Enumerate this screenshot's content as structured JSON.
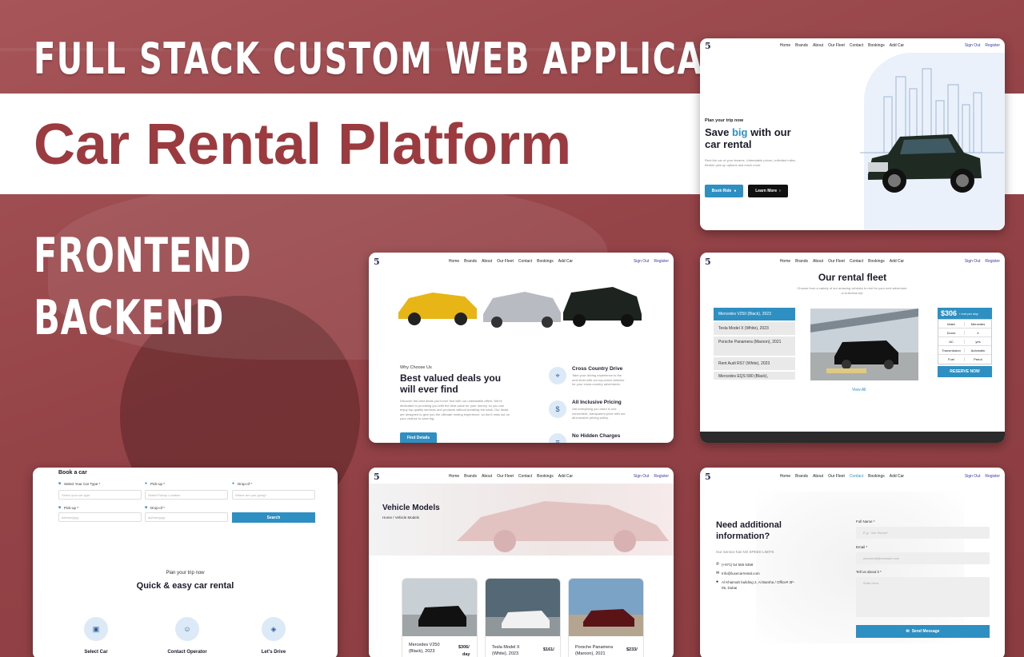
{
  "banner": {
    "headline": "FULL STACK CUSTOM WEB APPLICATION",
    "subtitle": "Car Rental Platform",
    "tags": [
      "FRONTEND",
      "BACKEND"
    ]
  },
  "nav": {
    "logo": "5",
    "links": [
      "Home",
      "Brands",
      "About",
      "Our Fleet",
      "Contact",
      "Bookings",
      "Add Car"
    ],
    "sign_out": "Sign Out",
    "register": "Register"
  },
  "hero": {
    "kicker": "Plan your trip now",
    "title_pre": "Save ",
    "title_accent": "big",
    "title_post": " with our",
    "title_line2": "car rental",
    "desc": "Rent the car of your dreams. Unbeatable prices, unlimited miles, flexible pick-up options and much more.",
    "book_ride": "Book Ride",
    "learn_more": "Learn More"
  },
  "why": {
    "kicker": "Why Choose Us",
    "title1": "Best valued deals you",
    "title2": "will ever find",
    "desc": "Discover the best deals you'll ever find with our unbeatable offers. We're dedicated to providing you with the best value for your money, so you can enjoy top-quality services and products without breaking the bank. Our deals are designed to give you the ultimate renting experience, so don't miss out on your chance to save big.",
    "find_details": "Find Details",
    "features": [
      {
        "title": "Cross Country Drive",
        "desc": "Take your driving experience to the next level with our top-notch vehicles for your cross-country adventures."
      },
      {
        "title": "All Inclusive Pricing",
        "desc": "Get everything you need in one convenient, transparent price with our all-inclusive pricing policy."
      },
      {
        "title": "No Hidden Charges",
        "desc": ""
      }
    ]
  },
  "fleet": {
    "title": "Our rental fleet",
    "desc": "Choose from a variety of our amazing vehicles to rent for your next adventure or business trip",
    "cars": [
      "Mercedes V250 (Black), 2023",
      "Tesla Model X (White), 2023",
      "Porsche Panamera (Maroon), 2021",
      "Rent Audi RS7 (White), 2023",
      "Mercedes EQS 580 (Black),"
    ],
    "price": "$306",
    "price_unit": "/ rent per day",
    "specs": [
      [
        "Make",
        "Mercedes"
      ],
      [
        "Doors",
        "4"
      ],
      [
        "AC",
        "yes"
      ],
      [
        "Transmission",
        "Automatic"
      ],
      [
        "Fuel",
        "Petrol"
      ]
    ],
    "reserve": "RESERVE NOW",
    "view_all": "View All"
  },
  "booking": {
    "title": "Book a car",
    "car_type_label": "Select Your Car Type *",
    "car_type_ph": "Select your car type",
    "pickup_label": "Pick-up *",
    "pickup_ph": "Select Pickup Location",
    "dropoff_label": "Drop-of *",
    "dropoff_ph": "Where are you going?",
    "pickup_date_label": "Pick-up *",
    "pickup_date_ph": "dd/mm/yyyy",
    "dropoff_date_label": "Drop-of *",
    "dropoff_date_ph": "dd/mm/yyyy",
    "search": "Search",
    "kicker": "Plan your trip now",
    "heading": "Quick & easy car rental",
    "steps": [
      "Select Car",
      "Contact Operator",
      "Let's Drive"
    ]
  },
  "models": {
    "title": "Vehicle Models",
    "crumb": "Home / Vehicle Models",
    "cards": [
      {
        "name1": "Mercedes V250",
        "name2": "(Black), 2023",
        "price1": "$306/",
        "price2": "day"
      },
      {
        "name1": "Tesla Model X",
        "name2": "(White), 2023",
        "price1": "$161/",
        "price2": ""
      },
      {
        "name1": "Porsche Panamera",
        "name2": "(Maroon), 2021",
        "price1": "$233/",
        "price2": ""
      }
    ]
  },
  "contact": {
    "title1": "Need additional",
    "title2": "information?",
    "desc": "Our Service has NO SPEED LIMITS",
    "phone": "(+971) 54 555 5358",
    "email": "Info@luxecarrental.com",
    "address1": "Al Khaimah building 2, Al Barsha / Office# 3F-",
    "address2": "05, Dubai",
    "name_label": "Full Name *",
    "name_ph": "E.g: \"Joe Shmoe\"",
    "email_label": "Email *",
    "email_ph": "youremail@example.com",
    "about_label": "Tell us about it *",
    "about_ph": "Write Here...",
    "send": "Send Message"
  }
}
